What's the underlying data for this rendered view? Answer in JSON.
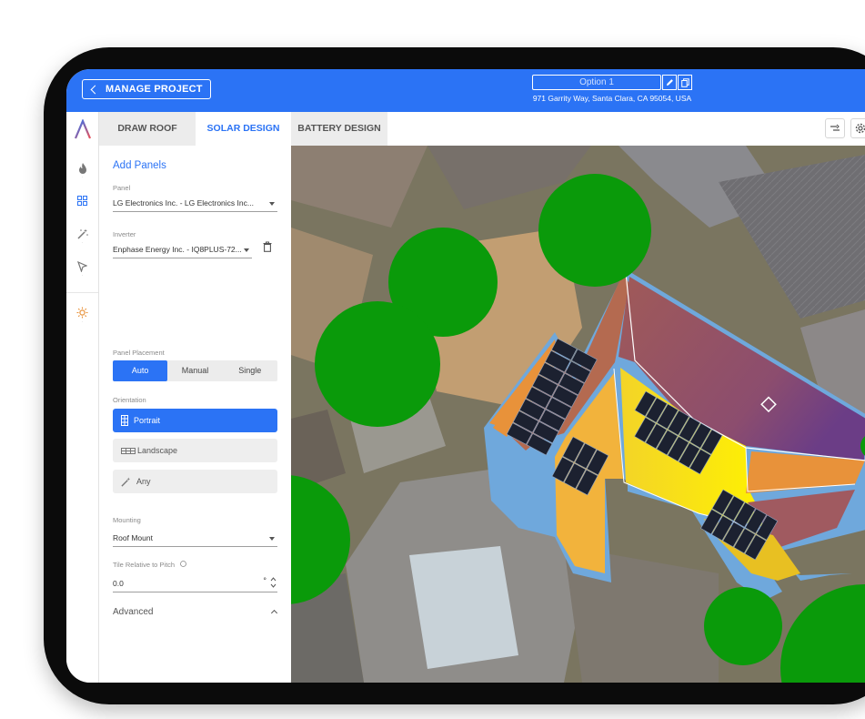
{
  "header": {
    "back_label": "MANAGE PROJECT",
    "option_name": "Option 1",
    "address": "971 Garrity Way, Santa Clara, CA 95054, USA"
  },
  "tabs": [
    {
      "label": "DRAW ROOF",
      "active": false
    },
    {
      "label": "SOLAR DESIGN",
      "active": true
    },
    {
      "label": "BATTERY DESIGN",
      "active": false
    }
  ],
  "rail": {
    "items": [
      {
        "icon": "fire-icon"
      },
      {
        "icon": "panel-grid-icon"
      },
      {
        "icon": "magic-wand-icon"
      },
      {
        "icon": "cursor-arrow-icon"
      },
      {
        "icon": "sun-icon"
      }
    ]
  },
  "panel": {
    "title": "Add Panels",
    "panel_label": "Panel",
    "panel_value": "LG Electronics Inc. - LG Electronics Inc...",
    "inverter_label": "Inverter",
    "inverter_value": "Enphase Energy Inc. - IQ8PLUS-72...",
    "placement_label": "Panel Placement",
    "placement_options": [
      "Auto",
      "Manual",
      "Single"
    ],
    "placement_selected": "Auto",
    "orientation_label": "Orientation",
    "orientation_options": [
      "Portrait",
      "Landscape",
      "Any"
    ],
    "orientation_selected": "Portrait",
    "mounting_label": "Mounting",
    "mounting_value": "Roof Mount",
    "tilt_label": "Tile Relative to Pitch",
    "tilt_value": "0.0",
    "tilt_unit": "°",
    "advanced_label": "Advanced"
  },
  "colors": {
    "brand_blue": "#2b73f5",
    "tree_green": "#0a9a0a",
    "roof_outline": "#6fa8dc",
    "shade_yellow": "#f2e61c",
    "shade_orange": "#e8923a",
    "shade_brown": "#b46a50",
    "shade_purple": "#8c4d6e"
  }
}
